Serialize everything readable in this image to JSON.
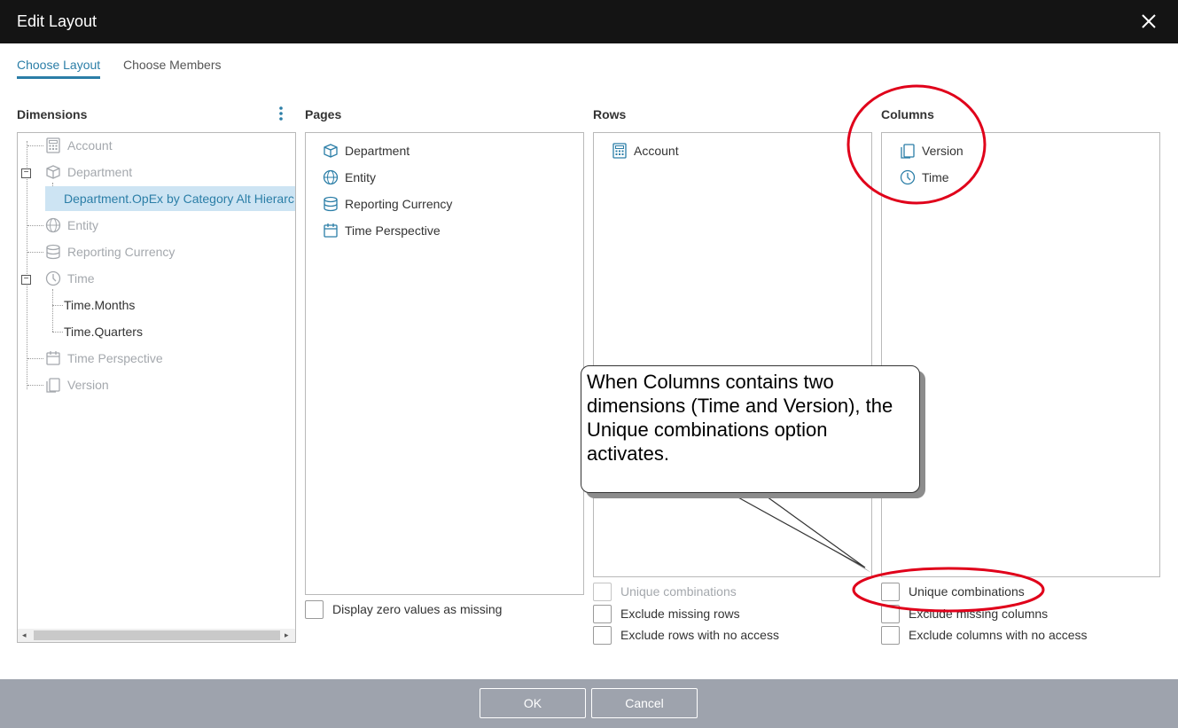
{
  "dialog": {
    "title": "Edit Layout"
  },
  "tabs": [
    {
      "label": "Choose Layout",
      "active": true
    },
    {
      "label": "Choose Members",
      "active": false
    }
  ],
  "headers": {
    "dimensions": "Dimensions",
    "pages": "Pages",
    "rows": "Rows",
    "columns": "Columns"
  },
  "dimensions_tree": [
    {
      "label": "Account",
      "icon": "calculator-icon",
      "state": "disabled"
    },
    {
      "label": "Department",
      "icon": "cube-icon",
      "state": "disabled",
      "expanded": true
    },
    {
      "label": "Department.OpEx by Category Alt Hierarc",
      "state": "selected"
    },
    {
      "label": "Entity",
      "icon": "globe-icon",
      "state": "disabled"
    },
    {
      "label": "Reporting Currency",
      "icon": "coins-icon",
      "state": "disabled"
    },
    {
      "label": "Time",
      "icon": "clock-icon",
      "state": "disabled",
      "expanded": true
    },
    {
      "label": "Time.Months",
      "state": "normal"
    },
    {
      "label": "Time.Quarters",
      "state": "normal"
    },
    {
      "label": "Time Perspective",
      "icon": "calendar-icon",
      "state": "disabled"
    },
    {
      "label": "Version",
      "icon": "copy-icon",
      "state": "disabled"
    }
  ],
  "pages": [
    {
      "label": "Department",
      "icon": "cube-icon"
    },
    {
      "label": "Entity",
      "icon": "globe-icon"
    },
    {
      "label": "Reporting Currency",
      "icon": "coins-icon"
    },
    {
      "label": "Time Perspective",
      "icon": "calendar-icon"
    }
  ],
  "rows": [
    {
      "label": "Account",
      "icon": "calculator-icon"
    }
  ],
  "columns": [
    {
      "label": "Version",
      "icon": "copy-icon"
    },
    {
      "label": "Time",
      "icon": "clock-icon"
    }
  ],
  "pages_options": {
    "display_zero": "Display zero values as missing"
  },
  "rows_options": {
    "unique": "Unique combinations",
    "exclude_missing": "Exclude missing rows",
    "exclude_no_access": "Exclude rows with no access"
  },
  "columns_options": {
    "unique": "Unique combinations",
    "exclude_missing": "Exclude missing columns",
    "exclude_no_access": "Exclude columns with no access"
  },
  "callout": {
    "text": "When Columns contains two dimensions (Time and Version), the Unique combinations option activates."
  },
  "buttons": {
    "ok": "OK",
    "cancel": "Cancel"
  },
  "colors": {
    "accent": "#2b7ea7",
    "titlebar": "#141414",
    "footer": "#9ea3ad",
    "annotation": "#e0001a"
  }
}
